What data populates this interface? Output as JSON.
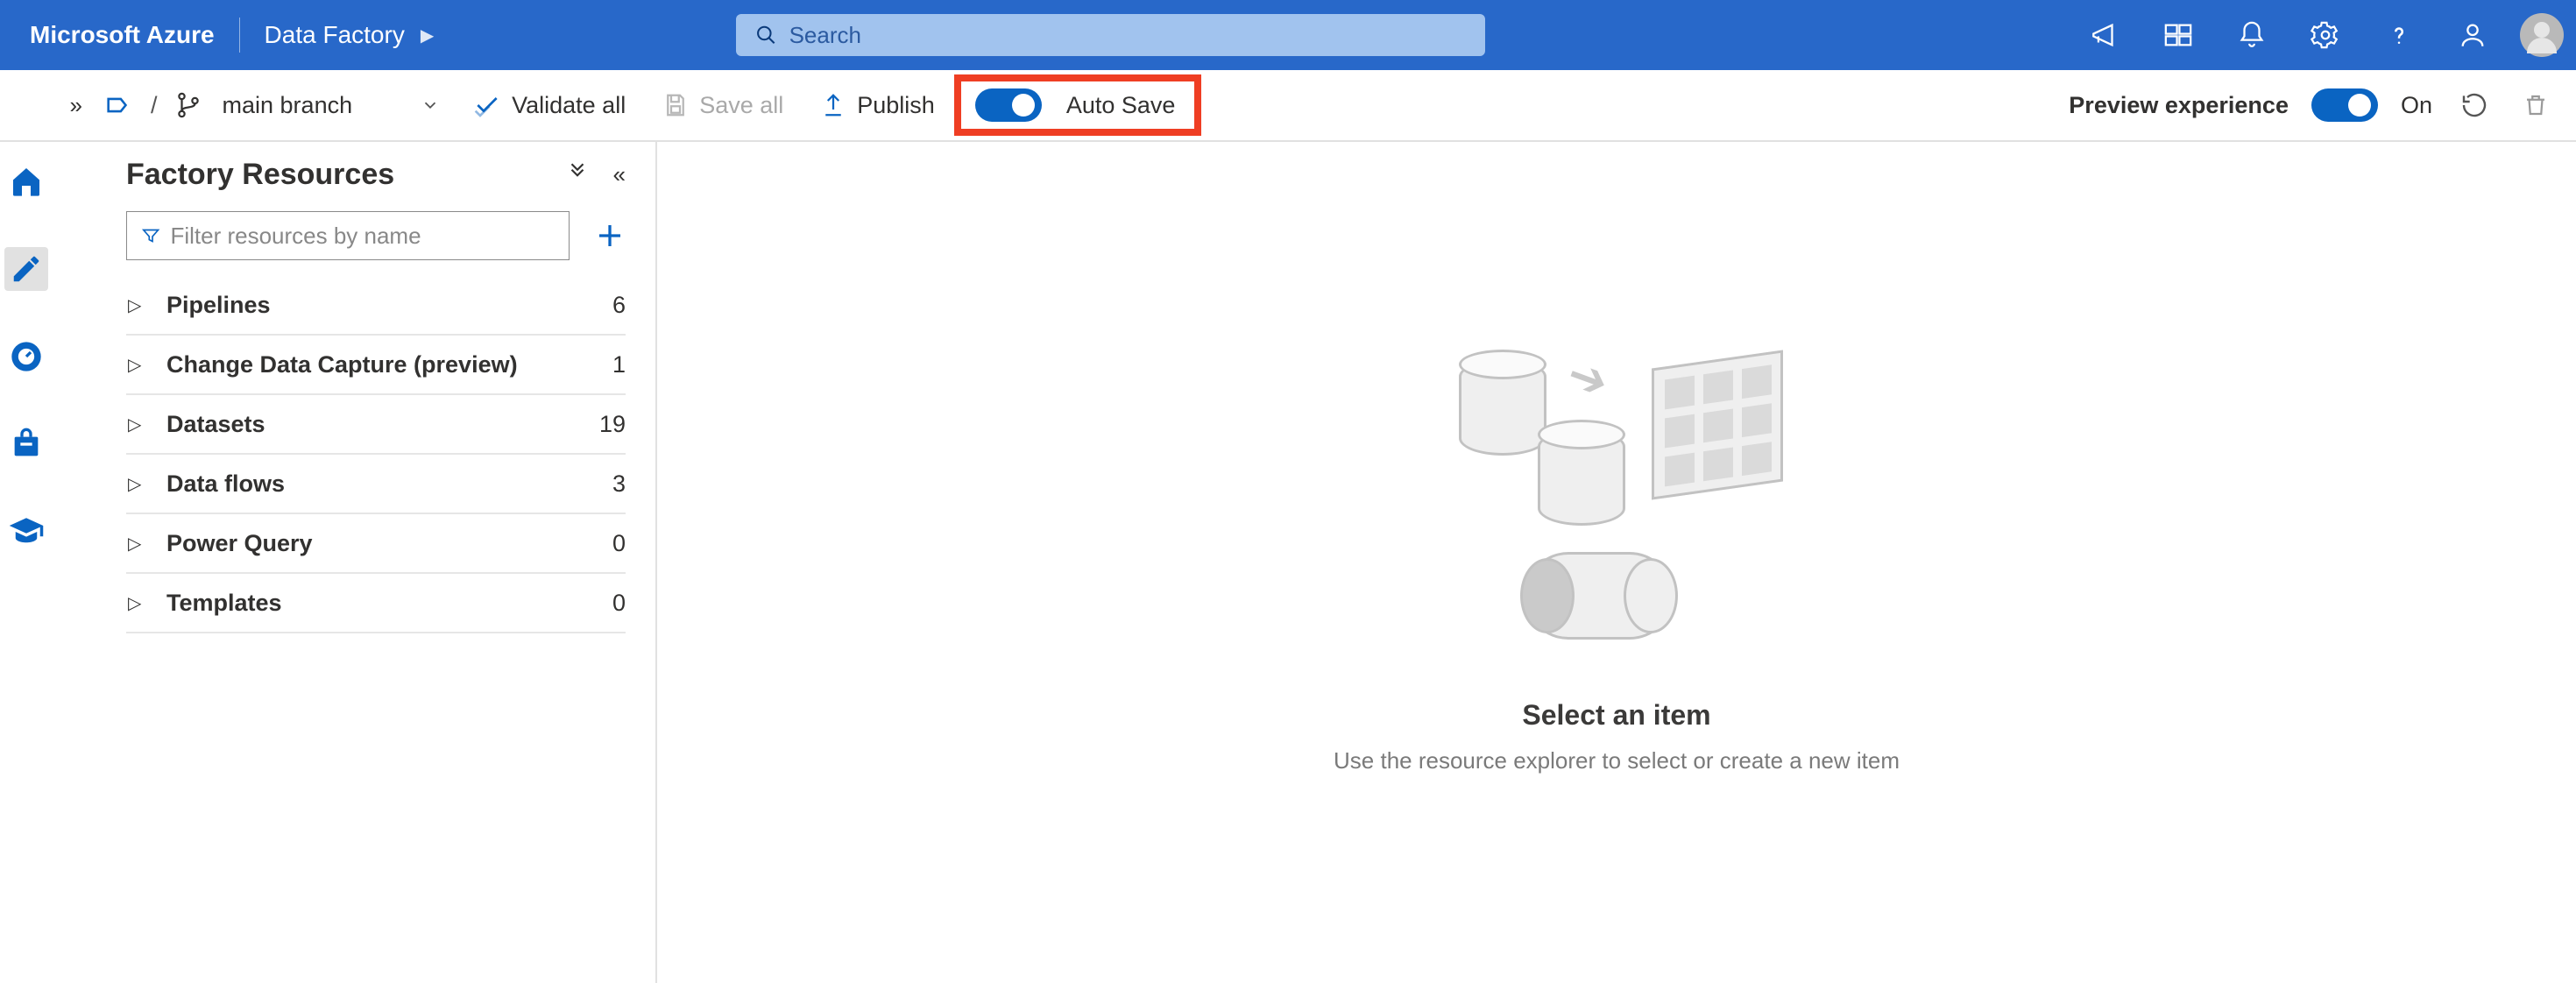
{
  "shell": {
    "brand": "Microsoft Azure",
    "crumb": "Data Factory",
    "search_placeholder": "Search"
  },
  "cmdbar": {
    "branch_label": "main branch",
    "validate_all": "Validate all",
    "save_all": "Save all",
    "publish": "Publish",
    "auto_save": "Auto Save",
    "preview_experience": "Preview experience",
    "on_label": "On"
  },
  "resources": {
    "title": "Factory Resources",
    "filter_placeholder": "Filter resources by name",
    "items": [
      {
        "label": "Pipelines",
        "count": "6"
      },
      {
        "label": "Change Data Capture (preview)",
        "count": "1"
      },
      {
        "label": "Datasets",
        "count": "19"
      },
      {
        "label": "Data flows",
        "count": "3"
      },
      {
        "label": "Power Query",
        "count": "0"
      },
      {
        "label": "Templates",
        "count": "0"
      }
    ]
  },
  "canvas": {
    "title": "Select an item",
    "subtitle": "Use the resource explorer to select or create a new item"
  }
}
